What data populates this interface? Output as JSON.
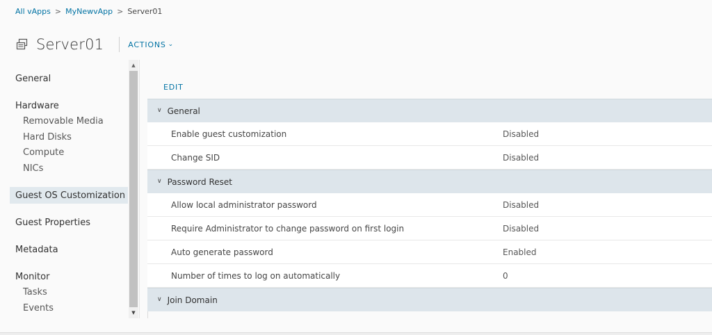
{
  "breadcrumb": {
    "items": [
      "All vApps",
      "MyNewvApp"
    ],
    "current": "Server01",
    "separator": ">"
  },
  "header": {
    "title": "Server01",
    "icon": "vm-icon",
    "actions_label": "ACTIONS"
  },
  "nav": {
    "general": "General",
    "hardware": "Hardware",
    "hardware_items": [
      "Removable Media",
      "Hard Disks",
      "Compute",
      "NICs"
    ],
    "guest_os": "Guest OS Customization",
    "guest_properties": "Guest Properties",
    "metadata": "Metadata",
    "monitor": "Monitor",
    "monitor_items": [
      "Tasks",
      "Events"
    ],
    "active": "Guest OS Customization"
  },
  "content": {
    "edit_label": "EDIT",
    "groups": [
      {
        "title": "General",
        "rows": [
          {
            "label": "Enable guest customization",
            "value": "Disabled"
          },
          {
            "label": "Change SID",
            "value": "Disabled"
          }
        ]
      },
      {
        "title": "Password Reset",
        "rows": [
          {
            "label": "Allow local administrator password",
            "value": "Disabled"
          },
          {
            "label": "Require Administrator to change password on first login",
            "value": "Disabled"
          },
          {
            "label": "Auto generate password",
            "value": "Enabled"
          },
          {
            "label": "Number of times to log on automatically",
            "value": "0"
          }
        ]
      },
      {
        "title": "Join Domain",
        "rows": []
      }
    ]
  },
  "colors": {
    "link": "#0072a3",
    "group_header_bg": "#dde5eb",
    "active_nav_bg": "#e1e9ee"
  }
}
